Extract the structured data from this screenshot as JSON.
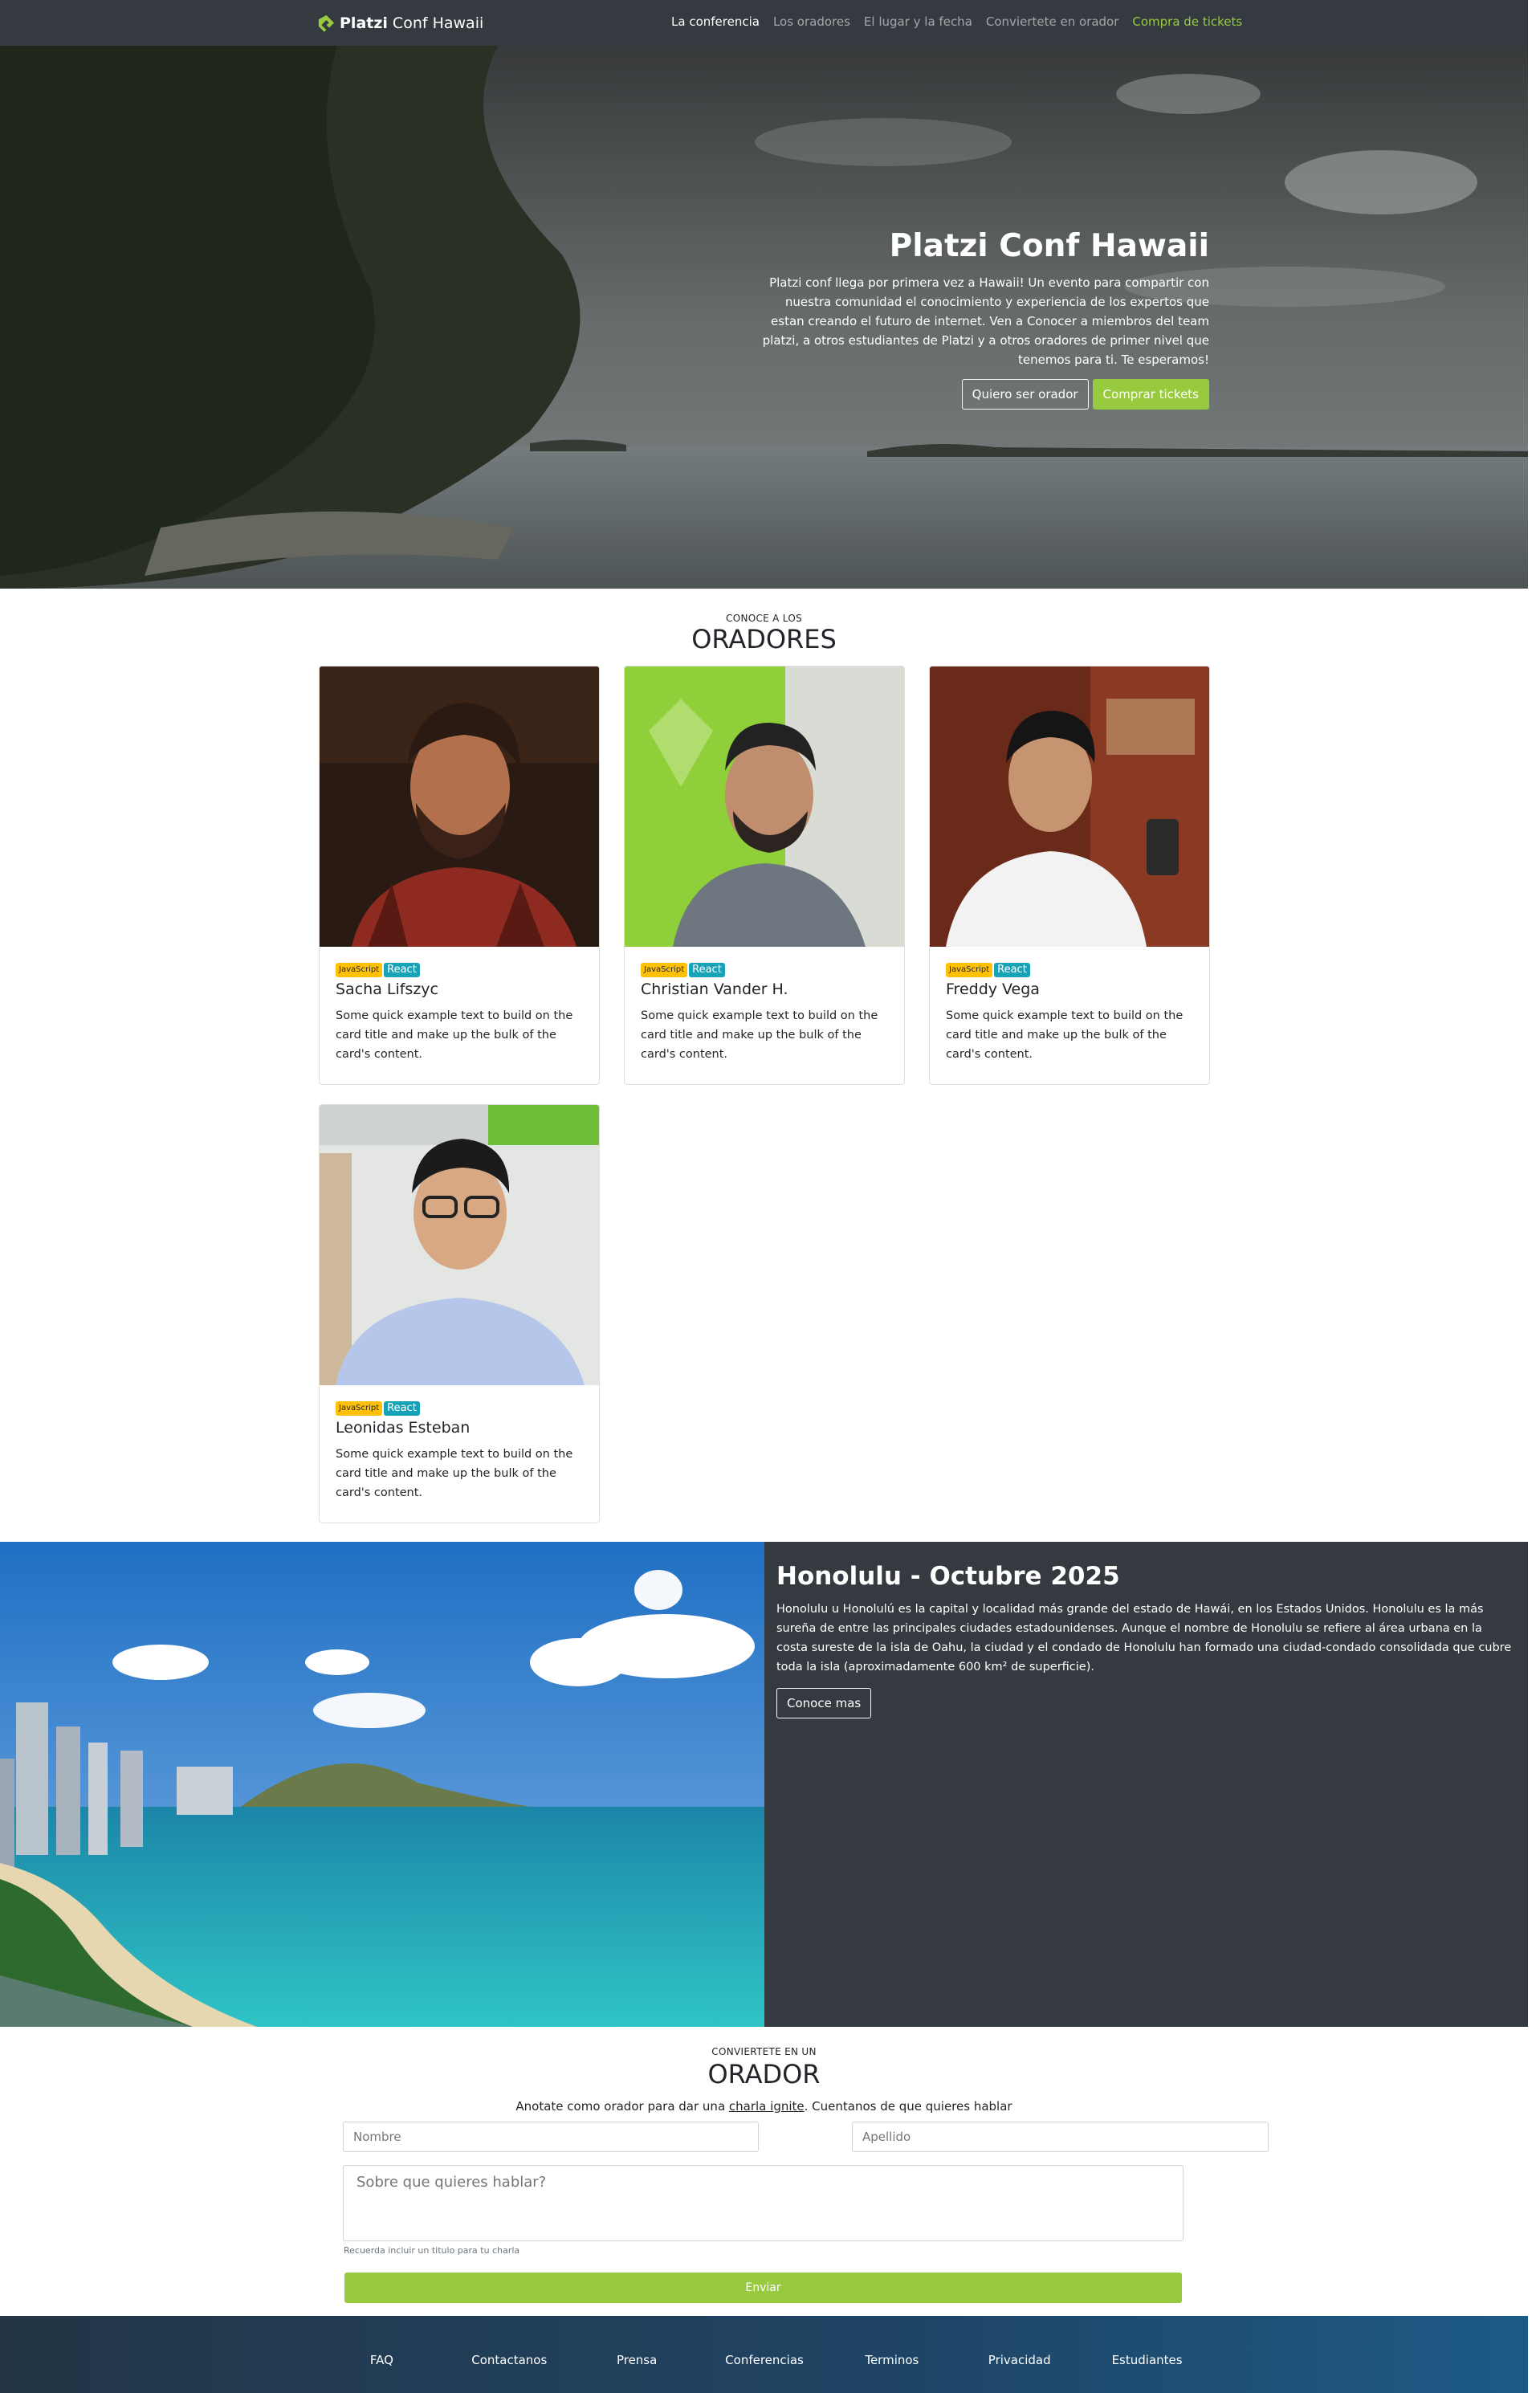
{
  "nav": {
    "brand_bold": "Platzi",
    "brand_rest": "Conf Hawaii",
    "links": [
      {
        "label": "La conferencia"
      },
      {
        "label": "Los oradores"
      },
      {
        "label": "El lugar y la fecha"
      },
      {
        "label": "Conviertete en orador"
      },
      {
        "label": "Compra de tickets"
      }
    ]
  },
  "hero": {
    "title": "Platzi Conf Hawaii",
    "text": "Platzi conf llega por primera vez a Hawaii! Un evento para compartir con nuestra comunidad el conocimiento y experiencia de los expertos que estan creando el futuro de internet. Ven a Conocer a miembros del team platzi, a otros estudiantes de Platzi y a otros oradores de primer nivel que tenemos para ti. Te esperamos!",
    "btn_speaker": "Quiero ser orador",
    "btn_tickets": "Comprar tickets"
  },
  "speakers": {
    "subtitle": "CONOCE A LOS",
    "title": "ORADORES",
    "items": [
      {
        "name": "Sacha Lifszyc",
        "badge1": "JavaScript",
        "badge2": "React",
        "text": "Some quick example text to build on the card title and make up the bulk of the card's content."
      },
      {
        "name": "Christian Vander H.",
        "badge1": "JavaScript",
        "badge2": "React",
        "text": "Some quick example text to build on the card title and make up the bulk of the card's content."
      },
      {
        "name": "Freddy Vega",
        "badge1": "JavaScript",
        "badge2": "React",
        "text": "Some quick example text to build on the card title and make up the bulk of the card's content."
      },
      {
        "name": "Leonidas Esteban",
        "badge1": "JavaScript",
        "badge2": "React",
        "text": "Some quick example text to build on the card title and make up the bulk of the card's content."
      }
    ]
  },
  "honolulu": {
    "title": "Honolulu - Octubre 2025",
    "text": "Honolulu u Honolulú es la capital y localidad más grande del estado de Hawái, en los Estados Unidos. Honolulu es la más sureña de entre las principales ciudades estadounidenses. Aunque el nombre de Honolulu se refiere al área urbana en la costa sureste de la isla de Oahu, la ciudad y el condado de Honolulu han formado una ciudad-condado consolidada que cubre toda la isla (aproximadamente 600 km² de superficie).",
    "button": "Conoce mas"
  },
  "form": {
    "subtitle": "CONVIERTETE EN UN",
    "title": "ORADOR",
    "lead_before": "Anotate como orador para dar una ",
    "lead_link": "charla ignite",
    "lead_after": ". Cuentanos de que quieres hablar",
    "name_placeholder": "Nombre",
    "lastname_placeholder": "Apellido",
    "topic_placeholder": "Sobre que quieres hablar?",
    "help": "Recuerda incluir un titulo para tu charla",
    "submit": "Enviar"
  },
  "footer": {
    "links": [
      {
        "label": "FAQ"
      },
      {
        "label": "Contactanos"
      },
      {
        "label": "Prensa"
      },
      {
        "label": "Conferencias"
      },
      {
        "label": "Terminos"
      },
      {
        "label": "Privacidad"
      },
      {
        "label": "Estudiantes"
      }
    ]
  },
  "colors": {
    "navbar": "#343a40",
    "accent_green": "#98ca3f",
    "badge_javascript": "#ffc107",
    "badge_react": "#17a2b8"
  }
}
